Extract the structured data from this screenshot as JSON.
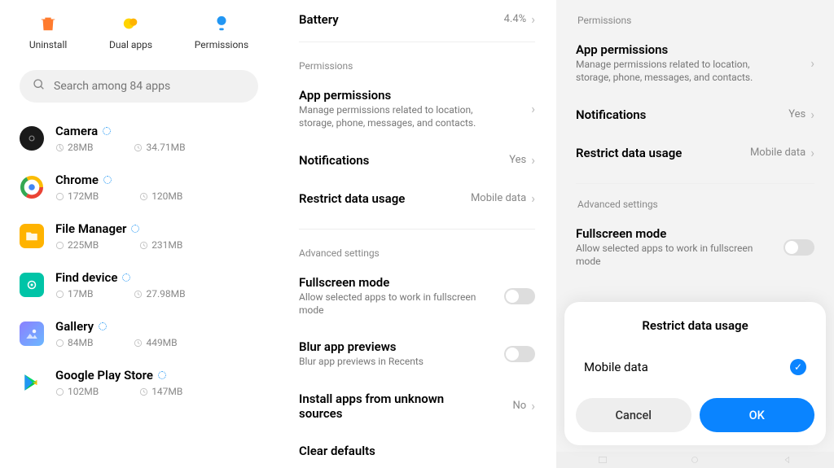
{
  "panel1": {
    "actions": {
      "uninstall": "Uninstall",
      "dual": "Dual apps",
      "permissions": "Permissions"
    },
    "search_placeholder": "Search among 84 apps",
    "apps": [
      {
        "name": "Camera",
        "storage": "28MB",
        "data": "34.71MB"
      },
      {
        "name": "Chrome",
        "storage": "172MB",
        "data": "120MB"
      },
      {
        "name": "File Manager",
        "storage": "225MB",
        "data": "231MB"
      },
      {
        "name": "Find device",
        "storage": "17MB",
        "data": "27.98MB"
      },
      {
        "name": "Gallery",
        "storage": "84MB",
        "data": "449MB"
      },
      {
        "name": "Google Play Store",
        "storage": "102MB",
        "data": "147MB"
      }
    ]
  },
  "panel2": {
    "battery": {
      "title": "Battery",
      "value": "4.4%"
    },
    "permissions_label": "Permissions",
    "app_permissions": {
      "title": "App permissions",
      "desc": "Manage permissions related to location, storage, phone, messages, and contacts."
    },
    "notifications": {
      "title": "Notifications",
      "value": "Yes"
    },
    "restrict": {
      "title": "Restrict data usage",
      "value": "Mobile data"
    },
    "advanced_label": "Advanced settings",
    "fullscreen": {
      "title": "Fullscreen mode",
      "desc": "Allow selected apps to work in fullscreen mode"
    },
    "blur": {
      "title": "Blur app previews",
      "desc": "Blur app previews in Recents"
    },
    "install": {
      "title": "Install apps from unknown sources",
      "value": "No"
    },
    "clear_defaults": "Clear defaults"
  },
  "panel3": {
    "permissions_label": "Permissions",
    "app_permissions": {
      "title": "App permissions",
      "desc": "Manage permissions related to location, storage, phone, messages, and contacts."
    },
    "notifications": {
      "title": "Notifications",
      "value": "Yes"
    },
    "restrict": {
      "title": "Restrict data usage",
      "value": "Mobile data"
    },
    "advanced_label": "Advanced settings",
    "fullscreen": {
      "title": "Fullscreen mode",
      "desc": "Allow selected apps to work in fullscreen mode"
    },
    "sheet": {
      "title": "Restrict data usage",
      "option": "Mobile data",
      "cancel": "Cancel",
      "ok": "OK"
    }
  }
}
